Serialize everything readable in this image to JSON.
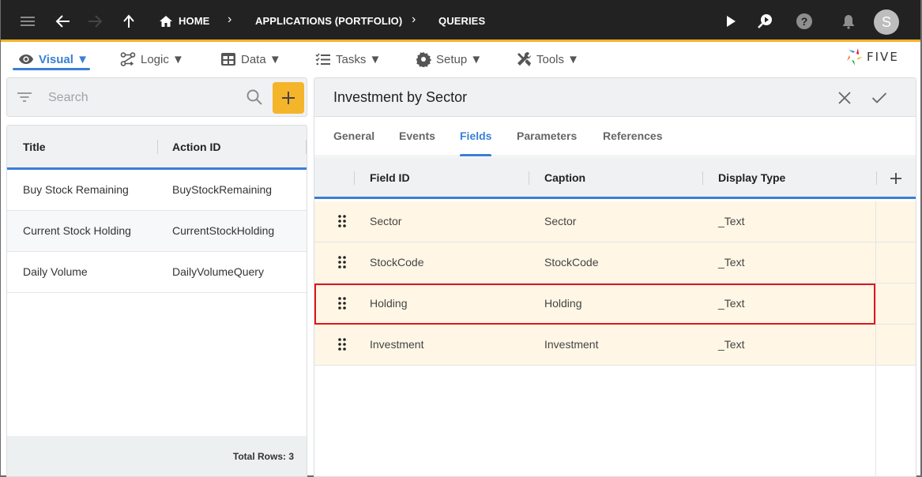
{
  "topbar": {
    "breadcrumbs": [
      "HOME",
      "APPLICATIONS (PORTFOLIO)",
      "QUERIES"
    ],
    "avatar_initial": "S",
    "accent_color": "#f4b223"
  },
  "menu": {
    "items": [
      {
        "label": "Visual ▼",
        "icon": "eye-icon",
        "active": true
      },
      {
        "label": "Logic ▼",
        "icon": "logic-flow-icon",
        "active": false
      },
      {
        "label": "Data ▼",
        "icon": "table-grid-icon",
        "active": false
      },
      {
        "label": "Tasks ▼",
        "icon": "checklist-icon",
        "active": false
      },
      {
        "label": "Setup ▼",
        "icon": "gear-icon",
        "active": false
      },
      {
        "label": "Tools ▼",
        "icon": "tools-icon",
        "active": false
      }
    ],
    "logo_text": "FIVE"
  },
  "left_panel": {
    "search": {
      "placeholder": "Search",
      "value": ""
    },
    "columns": [
      "Title",
      "Action ID"
    ],
    "rows": [
      {
        "title": "Buy Stock Remaining",
        "action_id": "BuyStockRemaining"
      },
      {
        "title": "Current Stock Holding",
        "action_id": "CurrentStockHolding"
      },
      {
        "title": "Daily Volume",
        "action_id": "DailyVolumeQuery"
      }
    ],
    "footer": "Total Rows: 3"
  },
  "detail": {
    "title": "Investment by Sector",
    "tabs": [
      {
        "label": "General",
        "active": false
      },
      {
        "label": "Events",
        "active": false
      },
      {
        "label": "Fields",
        "active": true
      },
      {
        "label": "Parameters",
        "active": false
      },
      {
        "label": "References",
        "active": false
      }
    ],
    "columns": [
      "Field ID",
      "Caption",
      "Display Type"
    ],
    "rows": [
      {
        "field_id": "Sector",
        "caption": "Sector",
        "display_type": "_Text",
        "selected": false
      },
      {
        "field_id": "StockCode",
        "caption": "StockCode",
        "display_type": "_Text",
        "selected": false
      },
      {
        "field_id": "Holding",
        "caption": "Holding",
        "display_type": "_Text",
        "selected": true
      },
      {
        "field_id": "Investment",
        "caption": "Investment",
        "display_type": "_Text",
        "selected": false
      }
    ]
  }
}
